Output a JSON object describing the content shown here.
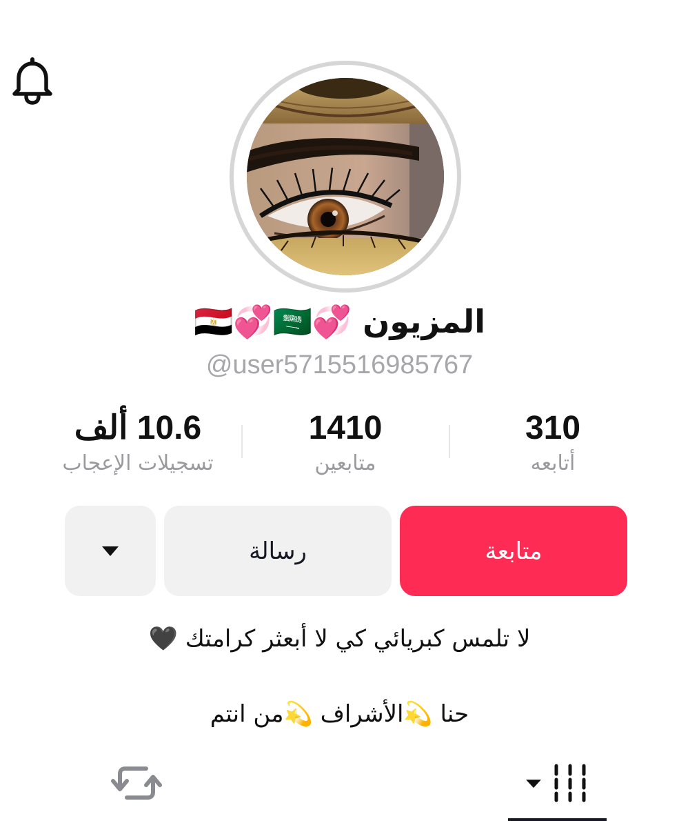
{
  "header": {
    "notification_icon": "bell-icon"
  },
  "profile": {
    "display_name": "المزيون 💞🇪🇬💞🇸🇦",
    "username": "@user5715516985767"
  },
  "stats": {
    "following": {
      "value": "310",
      "label": "أتابعه"
    },
    "followers": {
      "value": "1410",
      "label": "متابعين"
    },
    "likes": {
      "value": "10.6 ألف",
      "label": "تسجيلات الإعجاب"
    }
  },
  "actions": {
    "follow_label": "متابعة",
    "message_label": "رسالة",
    "more_icon": "caret-down-icon"
  },
  "bio": {
    "line1": "لا تلمس كبريائي كي لا أبعثر كرامتك 🖤",
    "line2": "حنا 💫الأشراف 💫من انتم"
  },
  "tabs": {
    "videos_icon": "grid-bars-icon",
    "reposts_icon": "repost-icon"
  },
  "colors": {
    "follow_button": "#fe2c55",
    "secondary_button": "#f1f1f2",
    "muted_text": "#9a9a9e"
  }
}
